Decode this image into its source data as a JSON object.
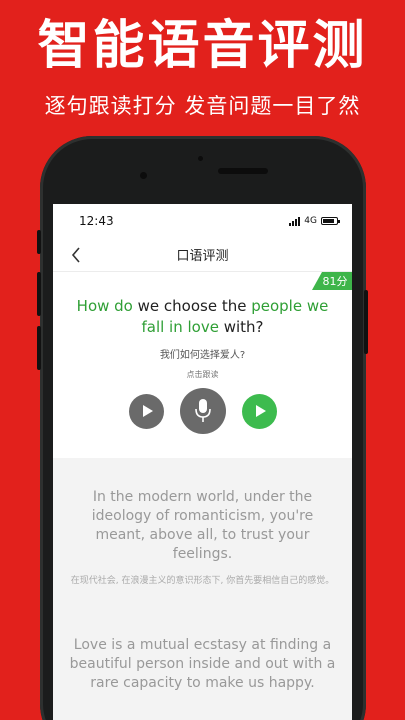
{
  "headline": "智能语音评测",
  "subline": "逐句跟读打分  发音问题一目了然",
  "status": {
    "time": "12:43",
    "network": "4G"
  },
  "nav": {
    "title": "口语评测"
  },
  "score": "81分",
  "sentence": {
    "part1": "How do",
    "part2": " we choose the ",
    "part3": "people we fall in love",
    "part4": " with?"
  },
  "translation": "我们如何选择爱人?",
  "hint": "点击跟读",
  "paragraphs": [
    {
      "en": "In the modern world, under the ideology of romanticism, you're meant, above all, to trust your feelings.",
      "zh": "在现代社会, 在浪漫主义的意识形态下, 你首先要相信自己的感觉。"
    },
    {
      "en": "Love is a mutual ecstasy at finding a beautiful person inside and out with a rare capacity to make us happy.",
      "zh": ""
    }
  ],
  "colors": {
    "brand_red": "#E2211C",
    "score_green": "#3eb54a",
    "highlight_green": "#2f9f35"
  },
  "icons": [
    "back-chevron-icon",
    "play-icon",
    "microphone-icon",
    "play-recording-icon",
    "signal-icon",
    "battery-icon"
  ]
}
